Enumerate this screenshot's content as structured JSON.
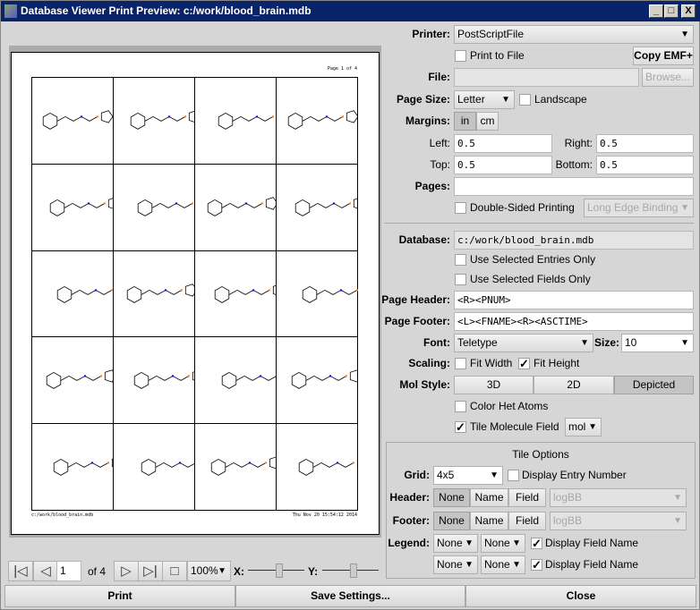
{
  "window": {
    "title": "Database Viewer Print Preview: c:/work/blood_brain.mdb",
    "minimize": "_",
    "maximize": "□",
    "close": "X"
  },
  "preview": {
    "header": "Page 1 of 4",
    "footer_left": "c:/work/blood_brain.mdb",
    "footer_right": "Thu Nov 20 15:54:12 2014",
    "rows": 5,
    "cols": 4
  },
  "nav": {
    "first": "|◁",
    "prev": "◁",
    "page": "1",
    "of": "of 4",
    "next": "▷",
    "last": "▷|",
    "fit": "□",
    "zoom": "100%",
    "x_label": "X:",
    "y_label": "Y:",
    "x_slider": 0.55,
    "y_slider": 0.55
  },
  "settings": {
    "printer_label": "Printer:",
    "printer": "PostScriptFile",
    "print_to_file": "Print to File",
    "copy_emf": "Copy EMF+",
    "file_label": "File:",
    "file": "",
    "browse": "Browse...",
    "page_size_label": "Page Size:",
    "page_size": "Letter",
    "landscape": "Landscape",
    "margins_label": "Margins:",
    "in": "in",
    "cm": "cm",
    "left_label": "Left:",
    "left": "0.5",
    "right_label": "Right:",
    "right": "0.5",
    "top_label": "Top:",
    "top": "0.5",
    "bottom_label": "Bottom:",
    "bottom": "0.5",
    "pages_label": "Pages:",
    "pages": "",
    "double_sided": "Double-Sided Printing",
    "binding": "Long Edge Binding",
    "database_label": "Database:",
    "database": "c:/work/blood_brain.mdb",
    "sel_entries": "Use Selected Entries Only",
    "sel_fields": "Use Selected Fields Only",
    "page_header_label": "Page Header:",
    "page_header": "<R><PNUM>",
    "page_footer_label": "Page Footer:",
    "page_footer": "<L><FNAME><R><ASCTIME>",
    "font_label": "Font:",
    "font": "Teletype",
    "size_label": "Size:",
    "size": "10",
    "scaling_label": "Scaling:",
    "fit_width": "Fit Width",
    "fit_height": "Fit Height",
    "mol_style_label": "Mol Style:",
    "style_3d": "3D",
    "style_2d": "2D",
    "style_depicted": "Depicted",
    "color_het": "Color Het Atoms",
    "tile_field": "Tile Molecule Field",
    "tile_field_value": "mol"
  },
  "tile": {
    "title": "Tile Options",
    "grid_label": "Grid:",
    "grid": "4x5",
    "entry_number": "Display Entry Number",
    "header_label": "Header:",
    "footer_label": "Footer:",
    "none": "None",
    "name": "Name",
    "field": "Field",
    "field_value": "logBB",
    "legend_label": "Legend:",
    "legend1a": "None",
    "legend1b": "None",
    "legend2a": "None",
    "legend2b": "None",
    "display_field_name": "Display Field Name"
  },
  "buttons": {
    "print": "Print",
    "save": "Save Settings...",
    "close": "Close"
  }
}
